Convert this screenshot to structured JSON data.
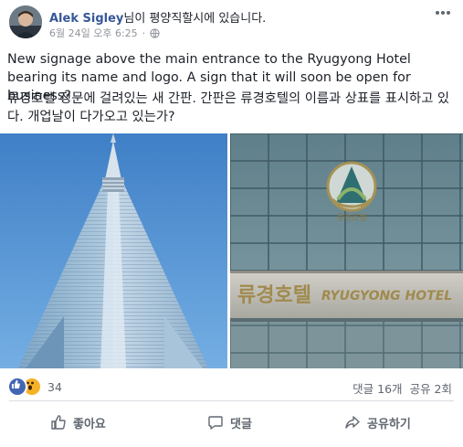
{
  "post": {
    "author": "Alek Sigley",
    "author_suffix": "님이 평양직할시에 있습니다.",
    "timestamp": "6월 24일 오후 6:25",
    "privacy_icon": "globe-icon",
    "text_en": "New signage above the main entrance to the Ryugyong Hotel bearing its name and logo. A sign that it will soon be open for business?",
    "text_ko": "류경호텔 정문에 걸려있는 새 간판. 간판은 류경호텔의 이름과 상표를 표시하고 있다. 개업날이 다가오고 있는가?",
    "sign_text_ko": "류경호텔",
    "sign_text_en": "RYUGYONG HOTEL",
    "logo_caption": "류경호텔"
  },
  "stats": {
    "reaction_count": "34",
    "comments": "댓글 16개",
    "shares": "공유 2회"
  },
  "actions": {
    "like": "좋아요",
    "comment": "댓글",
    "share": "공유하기"
  },
  "colors": {
    "link": "#365899",
    "like_blue": "#4267b2",
    "wow_yellow": "#f7b125",
    "muted": "#90949c"
  }
}
